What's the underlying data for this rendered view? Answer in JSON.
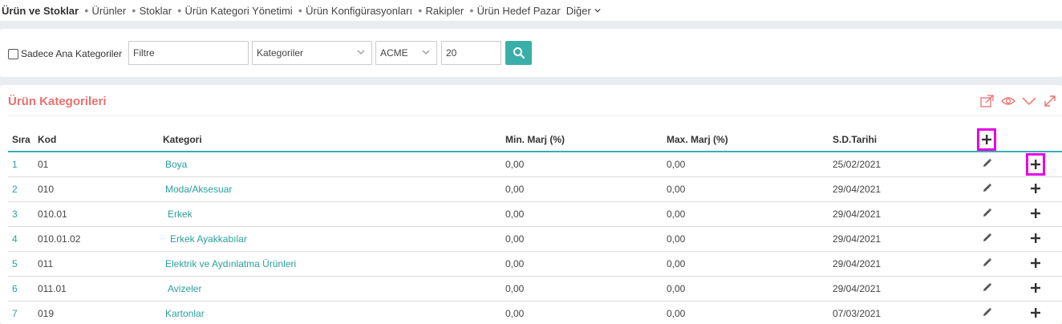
{
  "nav": {
    "brand": "Ürün ve Stoklar",
    "items": [
      "Ürünler",
      "Stoklar",
      "Ürün Kategori Yönetimi",
      "Ürün Konfigürasyonları",
      "Rakipler",
      "Ürün Hedef Pazar"
    ],
    "more": "Diğer"
  },
  "filters": {
    "main_only_label": "Sadece Ana Kategoriler",
    "filter_placeholder": "Filtre",
    "category_select": "Kategoriler",
    "company_select": "ACME",
    "page_size": "20",
    "search_icon": "search-icon"
  },
  "panel": {
    "title": "Ürün Kategorileri",
    "tools": [
      "export-icon",
      "eye-icon",
      "chevron-down-icon",
      "expand-icon"
    ]
  },
  "table": {
    "headers": [
      "Sıra",
      "Kod",
      "Kategori",
      "Min. Marj (%)",
      "Max. Marj (%)",
      "S.D.Tarihi"
    ],
    "rows": [
      {
        "sira": "1",
        "kod": "01",
        "kategori": "Boya",
        "min": "0,00",
        "max": "0,00",
        "tarih": "25/02/2021",
        "indent": 0
      },
      {
        "sira": "2",
        "kod": "010",
        "kategori": "Moda/Aksesuar",
        "min": "0,00",
        "max": "0,00",
        "tarih": "29/04/2021",
        "indent": 0
      },
      {
        "sira": "3",
        "kod": "010.01",
        "kategori": "Erkek",
        "min": "0,00",
        "max": "0,00",
        "tarih": "29/04/2021",
        "indent": 1
      },
      {
        "sira": "4",
        "kod": "010.01.02",
        "kategori": "Erkek Ayakkabılar",
        "min": "0,00",
        "max": "0,00",
        "tarih": "29/04/2021",
        "indent": 2
      },
      {
        "sira": "5",
        "kod": "011",
        "kategori": "Elektrik ve Aydınlatma Ürünleri",
        "min": "0,00",
        "max": "0,00",
        "tarih": "29/04/2021",
        "indent": 0
      },
      {
        "sira": "6",
        "kod": "011.01",
        "kategori": "Avizeler",
        "min": "0,00",
        "max": "0,00",
        "tarih": "29/04/2021",
        "indent": 1
      },
      {
        "sira": "7",
        "kod": "019",
        "kategori": "Kartonlar",
        "min": "0,00",
        "max": "0,00",
        "tarih": "07/03/2021",
        "indent": 0
      }
    ]
  },
  "colors": {
    "accent": "#3aafa9",
    "title": "#e8716f",
    "highlight": "#e600e6"
  }
}
